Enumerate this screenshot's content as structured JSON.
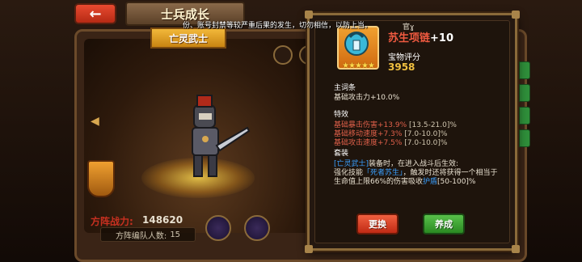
{
  "header": {
    "back_icon": "arrow-left-icon",
    "title": "士兵成长"
  },
  "unit": {
    "ribbon_name": "亡灵武士",
    "power_label": "方阵战力:",
    "power_value": "148620",
    "team_count_label": "方阵编队人数:",
    "team_count_value": "15"
  },
  "notice": "份、账号封禁等较严重后果的发生，切勿相信，以防上当。",
  "popup": {
    "corner_mark": "官ɣ",
    "item": {
      "name": "苏生项链",
      "level": "+10",
      "stars": "★★★★★",
      "score_label": "宝物评分",
      "score_value": "3958",
      "icon": "necklace-icon"
    },
    "main_title": "主词条",
    "main_stat": "基础攻击力+10.0%",
    "special_title": "特效",
    "special_stats": [
      {
        "bonus": "基础暴击伤害+13.9%",
        "range": "[13.5-21.0]%"
      },
      {
        "bonus": "基础移动速度+7.3%",
        "range": "[7.0-10.0]%"
      },
      {
        "bonus": "基础攻击速度+7.5%",
        "range": "[7.0-10.0]%"
      }
    ],
    "set_title": "套装",
    "set_lines": [
      {
        "tag": "[亡灵武士]",
        "text": "装备时，在进入战斗后生效:"
      },
      {
        "tag": "",
        "text": "强化技能",
        "tag2": "「死者苏生」",
        "text2": "，触发时还将获得一个相当于"
      },
      {
        "tag": "",
        "text": "生命值上限66%的伤害吸收",
        "tag2": "护盾",
        "text2": "[50-100]%"
      }
    ],
    "buttons": {
      "swap": "更换",
      "upgrade": "养成"
    }
  },
  "colors": {
    "accent_red": "#f05a40",
    "score_gold": "#f0c040",
    "set_tag_blue": "#3aa0ff",
    "upgrade_green": "#2a8a22"
  }
}
